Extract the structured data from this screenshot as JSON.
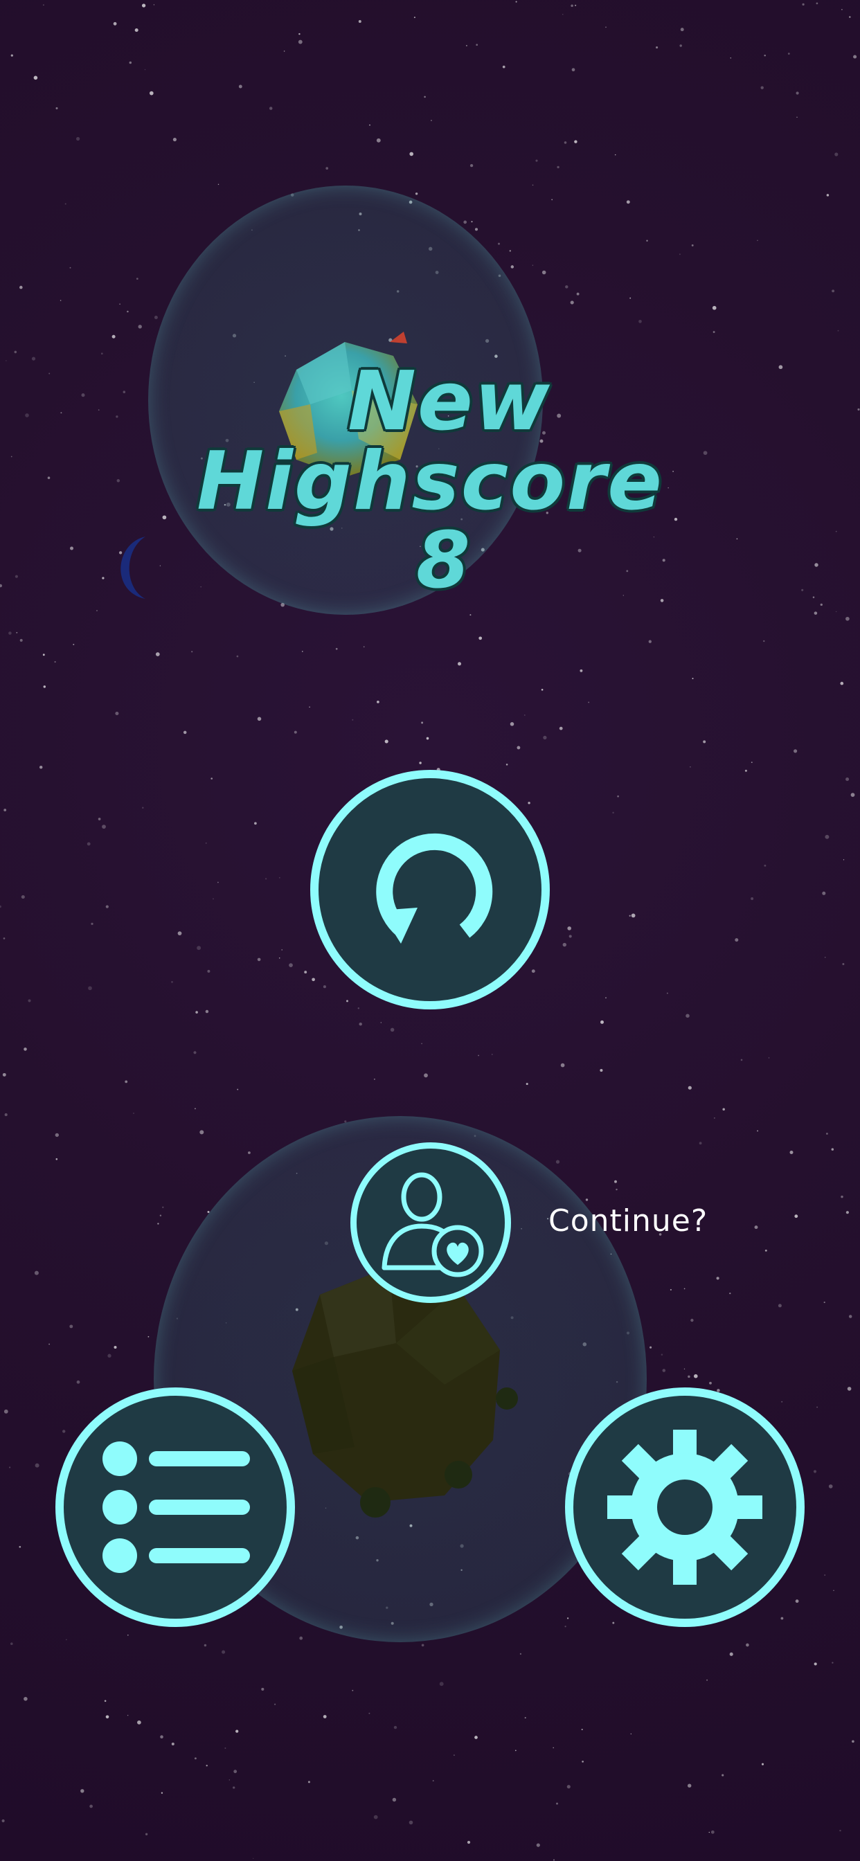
{
  "hud": {
    "title_line1": "New",
    "title_line2": "Highscore",
    "score": "8"
  },
  "continue_prompt": {
    "label": "Continue?"
  },
  "buttons": {
    "restart_icon": "restart-icon",
    "continue_icon": "user-heart-icon",
    "menu_icon": "list-icon",
    "settings_icon": "gear-icon"
  },
  "colors": {
    "accent": "#8ffcfc",
    "title": "#5fd8d8",
    "button_fill": "#1f3a44",
    "background": "#25102e"
  }
}
